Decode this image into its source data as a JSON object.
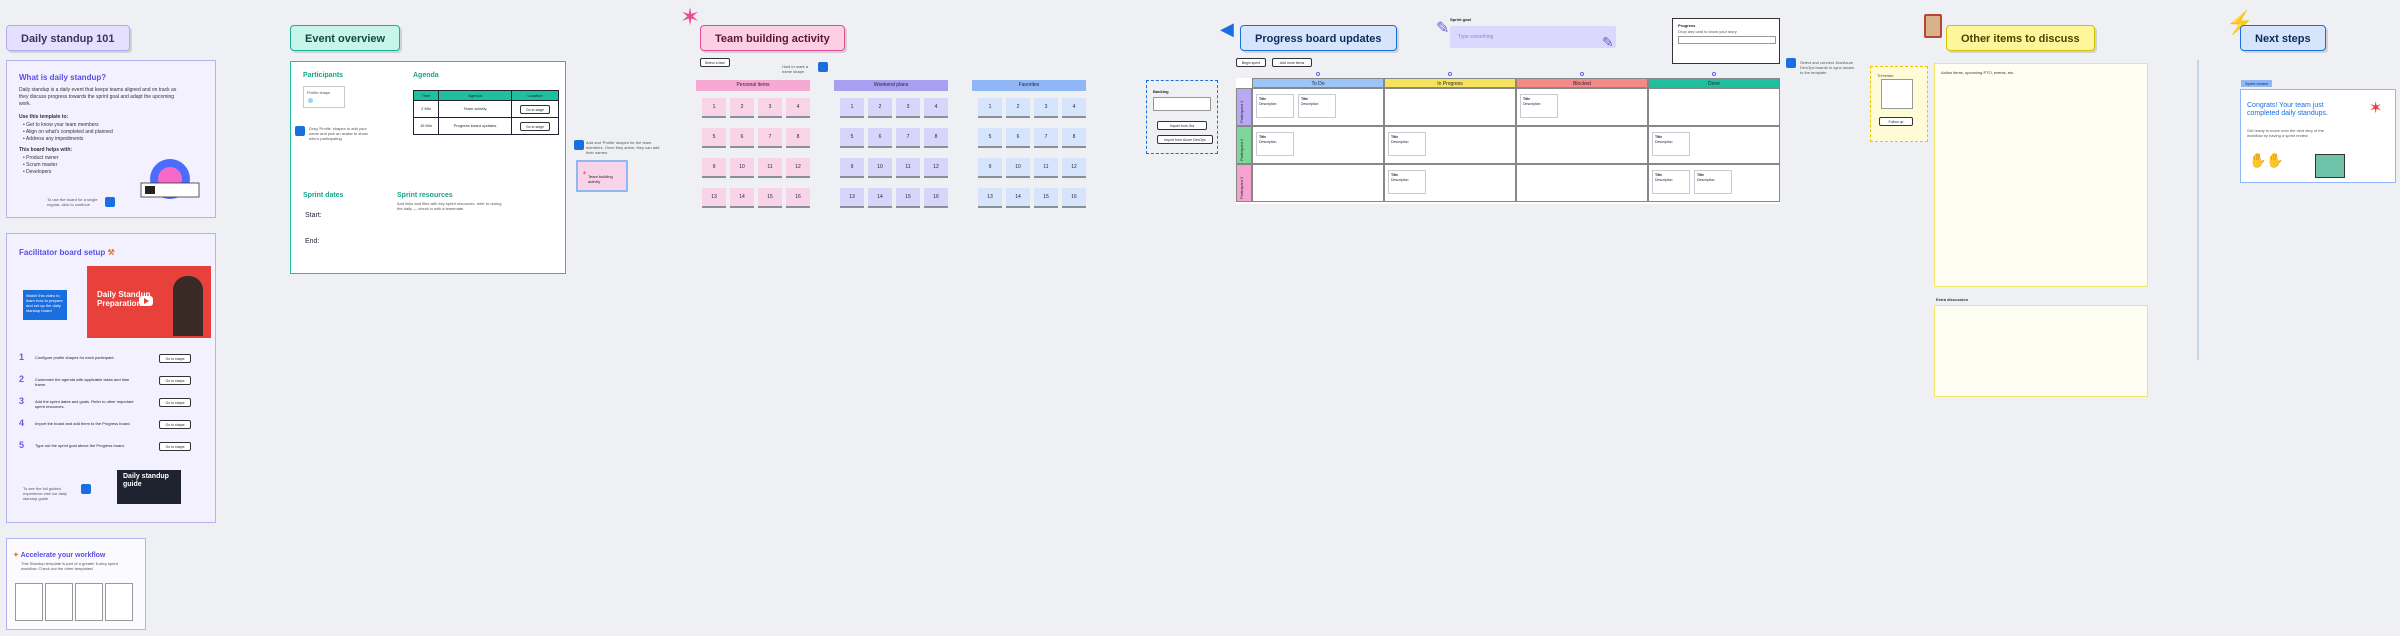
{
  "frames": {
    "standup101": "Daily standup 101",
    "event_overview": "Event overview",
    "team_building": "Team building activity",
    "progress_updates": "Progress board updates",
    "other_items": "Other items to discuss",
    "next_steps": "Next steps"
  },
  "intro": {
    "title": "What is daily standup?",
    "body": "Daily standup is a daily event that keeps teams aligned and on track as they discuss progress towards the sprint goal and adapt the upcoming work.",
    "use_heading": "Use this template to:",
    "bullets": [
      "Get to know your team members",
      "Align on what's completed and planned",
      "Address any impediments"
    ],
    "helps_heading": "This board helps with:",
    "helps": [
      "Product owner",
      "Scrum master",
      "Developers"
    ],
    "pin_note": "To use the board for a single regular, click to continue"
  },
  "facilitator": {
    "title": "Facilitator board setup",
    "video_title": "Daily Standup Preparation",
    "callout": "Watch this video to learn how to prepare and set up the daily standup board",
    "steps": [
      {
        "num": "1",
        "text": "Configure profile shapes for each participant.",
        "btn": "Go to shape"
      },
      {
        "num": "2",
        "text": "Customize the agenda with applicable tasks and time frame.",
        "btn": "Go to shape"
      },
      {
        "num": "3",
        "text": "Add the sprint dates and goals. Refer to other important sprint resources.",
        "btn": "Go to shape"
      },
      {
        "num": "4",
        "text": "Import the board and add them to the Progress board.",
        "btn": "Go to shape"
      },
      {
        "num": "5",
        "text": "Type out the sprint goal above the Progress board.",
        "btn": "Go to shape"
      }
    ],
    "guide_title": "Daily standup guide",
    "guide_note": "To see the full guided experience visit our daily standup guide"
  },
  "accelerate": {
    "title": "Accelerate your workflow",
    "body": "This Standup template is part of a greater 6-step sprint workflow. Check out the other templates!"
  },
  "event": {
    "participants": "Participants",
    "agenda": "Agenda",
    "agenda_cols": [
      "Time",
      "Agenda",
      "Location"
    ],
    "agenda_rows": [
      {
        "time": "2 Min",
        "item": "Team activity",
        "btn": "Go to stage"
      },
      {
        "time": "15 Min",
        "item": "Progress board updates",
        "btn": "Go to stage"
      }
    ],
    "sprint_dates": "Sprint dates",
    "start": "Start:",
    "end": "End:",
    "sprint_resources": "Sprint resources",
    "resources_note": "Add links and files with key sprint resources, refer to during the daily — check in with a teammate",
    "profile_label": "Profile shape",
    "pin_note": "Drag 'Profile' shapes to add your name and pick an avatar to show who's participating",
    "side_note": "Add and 'Profile' shapes for the team members. Once they arrive, they can add their names.",
    "sticky": "Team building activity"
  },
  "team": {
    "hint": "Select a face",
    "hint2": "Hold to mark a name shape",
    "columns": [
      {
        "name": "Personal items",
        "color": "#f5a8d1",
        "cell": "#f9d3e8"
      },
      {
        "name": "Weekend plans",
        "color": "#a99ef0",
        "cell": "#d9d4f9"
      },
      {
        "name": "Favorites",
        "color": "#8fb7f5",
        "cell": "#d6e5fc"
      }
    ],
    "rows": [
      [
        "1",
        "2",
        "3",
        "4"
      ],
      [
        "5",
        "6",
        "7",
        "8"
      ],
      [
        "9",
        "10",
        "11",
        "12"
      ],
      [
        "13",
        "14",
        "15",
        "16"
      ]
    ]
  },
  "progress": {
    "sprint_goal_label": "Sprint goal",
    "sprint_goal_placeholder": "Type something",
    "progress_box_title": "Progress",
    "progress_box_sub": "Drop any card to show your story",
    "buttons": [
      "Begin sprint",
      "Add more items"
    ],
    "side_buttons": [
      "Import from Jira",
      "Import from Azure DevOps"
    ],
    "backlog_label": "Backlog",
    "columns": [
      {
        "name": "To Do",
        "color": "#9ec5f7"
      },
      {
        "name": "In Progress",
        "color": "#f7e25d"
      },
      {
        "name": "Blocked",
        "color": "#f48a86"
      },
      {
        "name": "Done",
        "color": "#1fbfa0"
      }
    ],
    "lanes": [
      {
        "name": "Participant 1",
        "color": "#b9a8f4"
      },
      {
        "name": "Participant 2",
        "color": "#7ed69a"
      },
      {
        "name": "Participant 3",
        "color": "#f6a2cf"
      }
    ],
    "card_title": "Title",
    "card_sub": "Description",
    "side_note": "Select and connect Jira/Azure DevOps boards to sync issues to the template"
  },
  "other": {
    "placeholder": "Action items, upcoming PTO, events, etc.",
    "section2": "Extra discussion",
    "side_labels": [
      "Trimester",
      "Follow up"
    ]
  },
  "next": {
    "badge": "Sprint review",
    "congrats": "Congrats! Your team just completed daily standups.",
    "body": "Get ready to move onto the next step of the workflow by having a sprint review."
  },
  "colors": {
    "purple": "#6a5be2",
    "teal": "#17a28a",
    "pink": "#e84a93",
    "yellow": "#fff9a6",
    "blue_pin": "#1a6fe0"
  },
  "icons": [
    "party-popper-icon",
    "megaphone-icon",
    "clipboard-icon",
    "lightning-icon",
    "pencil-icon",
    "youtube-play-icon",
    "clapping-hands-icon"
  ]
}
